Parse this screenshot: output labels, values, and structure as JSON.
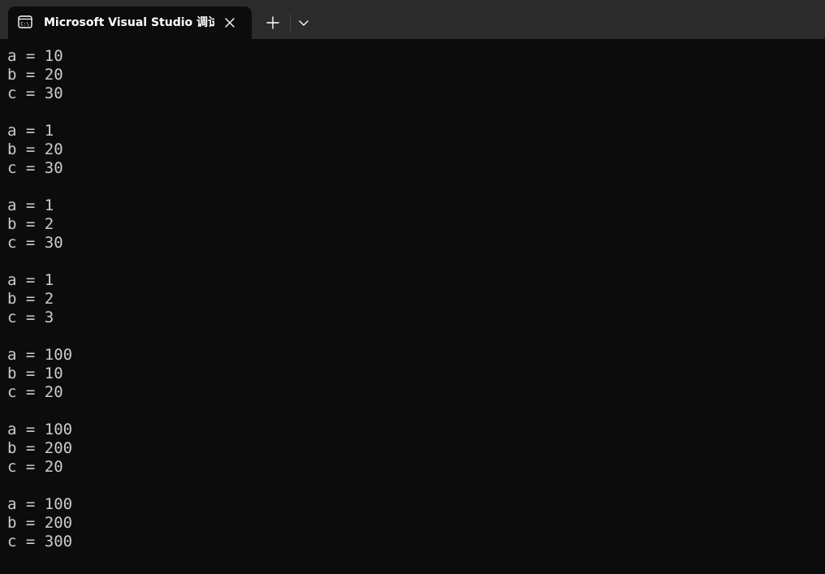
{
  "window": {
    "tab_title": "Microsoft Visual Studio 调试控",
    "icons": {
      "tab": "console-icon",
      "close": "close-icon",
      "new_tab": "plus-icon",
      "dropdown": "chevron-down-icon"
    },
    "colors": {
      "tabbar_bg": "#2b2b2b",
      "console_bg": "#0c0c0c",
      "text": "#cccccc"
    }
  },
  "console": {
    "lines": [
      "a = 10",
      "b = 20",
      "c = 30",
      "",
      "a = 1",
      "b = 20",
      "c = 30",
      "",
      "a = 1",
      "b = 2",
      "c = 30",
      "",
      "a = 1",
      "b = 2",
      "c = 3",
      "",
      "a = 100",
      "b = 10",
      "c = 20",
      "",
      "a = 100",
      "b = 200",
      "c = 20",
      "",
      "a = 100",
      "b = 200",
      "c = 300"
    ]
  }
}
